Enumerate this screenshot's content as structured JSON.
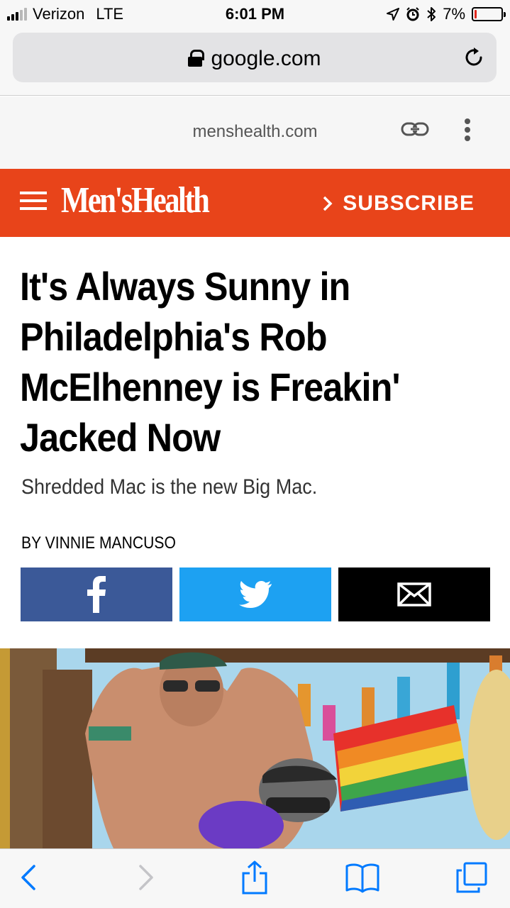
{
  "status_bar": {
    "carrier": "Verizon",
    "network": "LTE",
    "time": "6:01 PM",
    "battery_percent": "7%",
    "battery_level": 0.07,
    "signal_bars": 3,
    "signal_total": 5,
    "icons": [
      "location-arrow-icon",
      "alarm-icon",
      "bluetooth-icon",
      "battery-icon"
    ]
  },
  "browser": {
    "url": "google.com",
    "secure_icon": "lock-icon",
    "reload_icon": "reload-icon"
  },
  "amp_header": {
    "domain": "menshealth.com",
    "link_icon": "link-icon",
    "more_icon": "more-vertical-icon"
  },
  "site_header": {
    "logo": "Men'sHealth",
    "subscribe_label": "SUBSCRIBE",
    "brand_color": "#e8441a"
  },
  "article": {
    "headline": "It's Always Sunny in Philadelphia's Rob McElhenney is Freakin' Jacked Now",
    "dek": "Shredded Mac is the new Big Mac.",
    "byline": "BY VINNIE MANCUSO"
  },
  "share": [
    {
      "name": "facebook",
      "icon": "facebook-icon",
      "color": "#3b5998"
    },
    {
      "name": "twitter",
      "icon": "twitter-icon",
      "color": "#1da1f2"
    },
    {
      "name": "email",
      "icon": "envelope-icon",
      "color": "#000000"
    }
  ],
  "toolbar": {
    "buttons": [
      "back-icon",
      "forward-icon",
      "share-icon",
      "bookmarks-icon",
      "tabs-icon"
    ],
    "accent": "#007aff"
  }
}
